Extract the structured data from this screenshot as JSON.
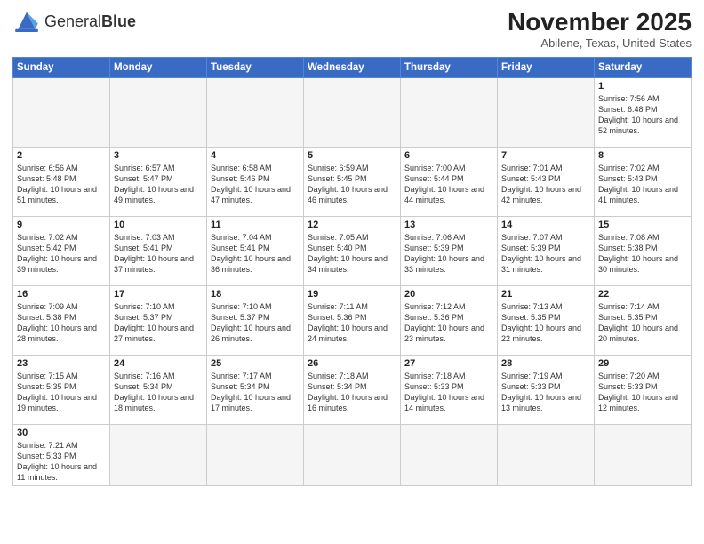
{
  "logo": {
    "text_regular": "General",
    "text_bold": "Blue"
  },
  "header": {
    "month": "November 2025",
    "location": "Abilene, Texas, United States"
  },
  "weekdays": [
    "Sunday",
    "Monday",
    "Tuesday",
    "Wednesday",
    "Thursday",
    "Friday",
    "Saturday"
  ],
  "weeks": [
    [
      {
        "day": "",
        "info": ""
      },
      {
        "day": "",
        "info": ""
      },
      {
        "day": "",
        "info": ""
      },
      {
        "day": "",
        "info": ""
      },
      {
        "day": "",
        "info": ""
      },
      {
        "day": "",
        "info": ""
      },
      {
        "day": "1",
        "info": "Sunrise: 7:56 AM\nSunset: 6:48 PM\nDaylight: 10 hours and 52 minutes."
      }
    ],
    [
      {
        "day": "2",
        "info": "Sunrise: 6:56 AM\nSunset: 5:48 PM\nDaylight: 10 hours and 51 minutes."
      },
      {
        "day": "3",
        "info": "Sunrise: 6:57 AM\nSunset: 5:47 PM\nDaylight: 10 hours and 49 minutes."
      },
      {
        "day": "4",
        "info": "Sunrise: 6:58 AM\nSunset: 5:46 PM\nDaylight: 10 hours and 47 minutes."
      },
      {
        "day": "5",
        "info": "Sunrise: 6:59 AM\nSunset: 5:45 PM\nDaylight: 10 hours and 46 minutes."
      },
      {
        "day": "6",
        "info": "Sunrise: 7:00 AM\nSunset: 5:44 PM\nDaylight: 10 hours and 44 minutes."
      },
      {
        "day": "7",
        "info": "Sunrise: 7:01 AM\nSunset: 5:43 PM\nDaylight: 10 hours and 42 minutes."
      },
      {
        "day": "8",
        "info": "Sunrise: 7:02 AM\nSunset: 5:43 PM\nDaylight: 10 hours and 41 minutes."
      }
    ],
    [
      {
        "day": "9",
        "info": "Sunrise: 7:02 AM\nSunset: 5:42 PM\nDaylight: 10 hours and 39 minutes."
      },
      {
        "day": "10",
        "info": "Sunrise: 7:03 AM\nSunset: 5:41 PM\nDaylight: 10 hours and 37 minutes."
      },
      {
        "day": "11",
        "info": "Sunrise: 7:04 AM\nSunset: 5:41 PM\nDaylight: 10 hours and 36 minutes."
      },
      {
        "day": "12",
        "info": "Sunrise: 7:05 AM\nSunset: 5:40 PM\nDaylight: 10 hours and 34 minutes."
      },
      {
        "day": "13",
        "info": "Sunrise: 7:06 AM\nSunset: 5:39 PM\nDaylight: 10 hours and 33 minutes."
      },
      {
        "day": "14",
        "info": "Sunrise: 7:07 AM\nSunset: 5:39 PM\nDaylight: 10 hours and 31 minutes."
      },
      {
        "day": "15",
        "info": "Sunrise: 7:08 AM\nSunset: 5:38 PM\nDaylight: 10 hours and 30 minutes."
      }
    ],
    [
      {
        "day": "16",
        "info": "Sunrise: 7:09 AM\nSunset: 5:38 PM\nDaylight: 10 hours and 28 minutes."
      },
      {
        "day": "17",
        "info": "Sunrise: 7:10 AM\nSunset: 5:37 PM\nDaylight: 10 hours and 27 minutes."
      },
      {
        "day": "18",
        "info": "Sunrise: 7:10 AM\nSunset: 5:37 PM\nDaylight: 10 hours and 26 minutes."
      },
      {
        "day": "19",
        "info": "Sunrise: 7:11 AM\nSunset: 5:36 PM\nDaylight: 10 hours and 24 minutes."
      },
      {
        "day": "20",
        "info": "Sunrise: 7:12 AM\nSunset: 5:36 PM\nDaylight: 10 hours and 23 minutes."
      },
      {
        "day": "21",
        "info": "Sunrise: 7:13 AM\nSunset: 5:35 PM\nDaylight: 10 hours and 22 minutes."
      },
      {
        "day": "22",
        "info": "Sunrise: 7:14 AM\nSunset: 5:35 PM\nDaylight: 10 hours and 20 minutes."
      }
    ],
    [
      {
        "day": "23",
        "info": "Sunrise: 7:15 AM\nSunset: 5:35 PM\nDaylight: 10 hours and 19 minutes."
      },
      {
        "day": "24",
        "info": "Sunrise: 7:16 AM\nSunset: 5:34 PM\nDaylight: 10 hours and 18 minutes."
      },
      {
        "day": "25",
        "info": "Sunrise: 7:17 AM\nSunset: 5:34 PM\nDaylight: 10 hours and 17 minutes."
      },
      {
        "day": "26",
        "info": "Sunrise: 7:18 AM\nSunset: 5:34 PM\nDaylight: 10 hours and 16 minutes."
      },
      {
        "day": "27",
        "info": "Sunrise: 7:18 AM\nSunset: 5:33 PM\nDaylight: 10 hours and 14 minutes."
      },
      {
        "day": "28",
        "info": "Sunrise: 7:19 AM\nSunset: 5:33 PM\nDaylight: 10 hours and 13 minutes."
      },
      {
        "day": "29",
        "info": "Sunrise: 7:20 AM\nSunset: 5:33 PM\nDaylight: 10 hours and 12 minutes."
      }
    ],
    [
      {
        "day": "30",
        "info": "Sunrise: 7:21 AM\nSunset: 5:33 PM\nDaylight: 10 hours and 11 minutes."
      },
      {
        "day": "",
        "info": ""
      },
      {
        "day": "",
        "info": ""
      },
      {
        "day": "",
        "info": ""
      },
      {
        "day": "",
        "info": ""
      },
      {
        "day": "",
        "info": ""
      },
      {
        "day": "",
        "info": ""
      }
    ]
  ]
}
